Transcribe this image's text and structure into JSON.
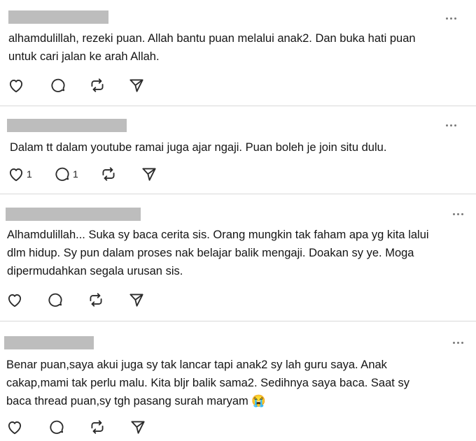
{
  "posts": [
    {
      "text": "alhamdulillah, rezeki puan. Allah bantu puan melalui anak2. Dan buka hati puan\nuntuk cari jalan ke arah Allah.",
      "like_count": "",
      "reply_count": ""
    },
    {
      "text": "Dalam tt dalam youtube ramai juga ajar ngaji. Puan boleh je join situ dulu.",
      "like_count": "1",
      "reply_count": "1"
    },
    {
      "text": "Alhamdulillah... Suka sy baca cerita sis. Orang mungkin tak faham apa yg kita lalui\ndlm hidup. Sy pun dalam proses nak belajar balik mengaji. Doakan sy ye. Moga\ndipermudahkan segala urusan sis.",
      "like_count": "",
      "reply_count": ""
    },
    {
      "text": "Benar puan,saya akui juga sy tak lancar tapi anak2 sy lah guru saya. Anak\ncakap,mami tak perlu malu. Kita bljr balik sama2. Sedihnya saya baca. Saat sy\nbaca thread puan,sy tgh pasang surah maryam 😭",
      "like_count": "",
      "reply_count": ""
    }
  ],
  "icons": {
    "like": "heart-icon",
    "reply": "comment-icon",
    "repost": "repost-icon",
    "share": "send-icon",
    "more": "more-options-icon"
  },
  "colors": {
    "text": "#151515",
    "icon": "#2b2b2b",
    "redaction": "#bdbdbd",
    "divider": "#d9d9d9"
  }
}
